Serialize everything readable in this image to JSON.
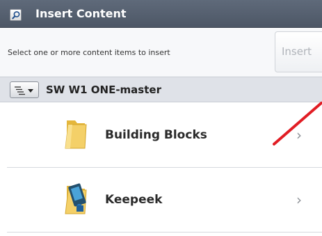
{
  "window": {
    "title": "Insert Content",
    "search_icon": "search-icon"
  },
  "toolbar": {
    "instructions": "Select one or more content items to insert",
    "insert_label": "Insert"
  },
  "repository": {
    "menu_icon": "list-menu-icon",
    "title": "SW W1 ONE-master"
  },
  "items": [
    {
      "label": "Building Blocks",
      "icon": "folder-icon",
      "chevron": "›"
    },
    {
      "label": "Keepeek",
      "icon": "app-folder-icon",
      "chevron": "›"
    }
  ],
  "colors": {
    "titlebar": "#56606f",
    "annotation_line": "#e11d24",
    "folder": "#f2c94c"
  }
}
